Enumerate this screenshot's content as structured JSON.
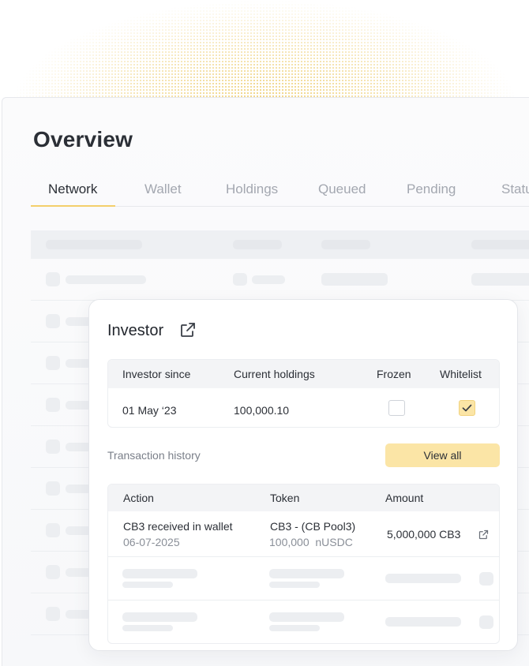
{
  "page": {
    "title": "Overview"
  },
  "tabs": [
    {
      "label": "Network",
      "active": true
    },
    {
      "label": "Wallet",
      "active": false
    },
    {
      "label": "Holdings",
      "active": false
    },
    {
      "label": "Queued",
      "active": false
    },
    {
      "label": "Pending",
      "active": false
    },
    {
      "label": "Statu",
      "active": false
    }
  ],
  "investor_card": {
    "title": "Investor",
    "title_icon": "external-link-icon",
    "columns": [
      "Investor since",
      "Current holdings",
      "Frozen",
      "Whitelist"
    ],
    "row": {
      "investor_since": "01 May ‘23",
      "current_holdings": "100,000.10",
      "frozen": false,
      "whitelist": true
    },
    "transaction_history_label": "Transaction history",
    "view_all_label": "View all",
    "tx_columns": [
      "Action",
      "Token",
      "Amount"
    ],
    "transactions": [
      {
        "action": "CB3 received in wallet",
        "date": "06-07-2025",
        "token": "CB3 - (CB Pool3)",
        "token_sub": "100,000  nUSDC",
        "amount": "5,000,000 CB3",
        "amount_icon": "external-link-icon"
      }
    ]
  },
  "colors": {
    "accent": "#fbe5a6",
    "accent_border": "#f1d27e",
    "tab_underline": "#f3cf6b",
    "halo_dots": "#e8be46"
  }
}
